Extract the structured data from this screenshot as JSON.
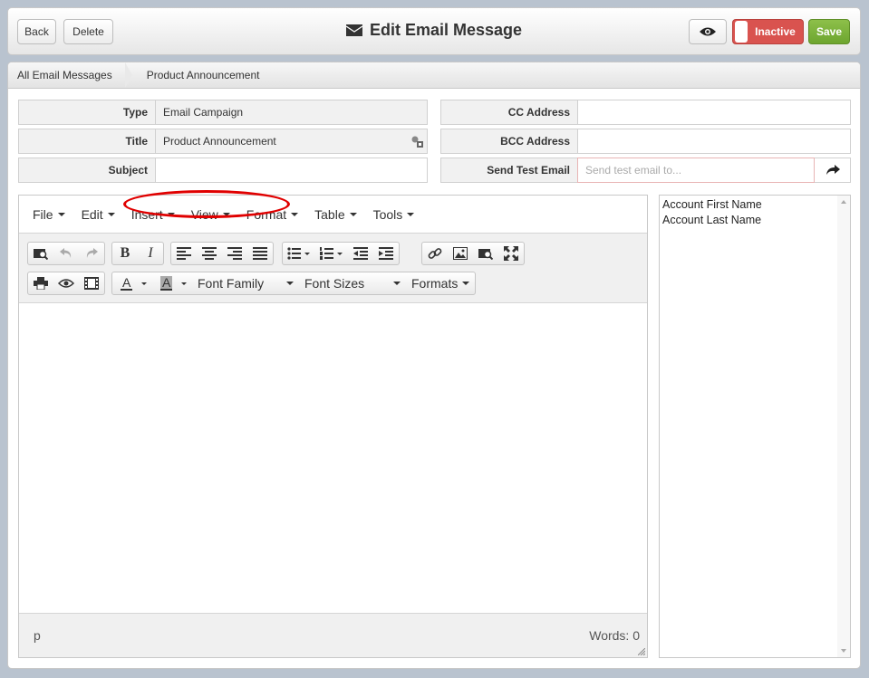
{
  "header": {
    "back_label": "Back",
    "delete_label": "Delete",
    "title": "Edit Email Message",
    "status_label": "Inactive",
    "save_label": "Save"
  },
  "breadcrumb": [
    "All Email Messages",
    "Product Announcement"
  ],
  "form": {
    "type": {
      "label": "Type",
      "value": "Email Campaign"
    },
    "title": {
      "label": "Title",
      "value": "Product Announcement"
    },
    "subject": {
      "label": "Subject",
      "value": ""
    },
    "cc": {
      "label": "CC Address",
      "value": ""
    },
    "bcc": {
      "label": "BCC Address",
      "value": ""
    },
    "test": {
      "label": "Send Test Email",
      "placeholder": "Send test email to..."
    }
  },
  "editor": {
    "menus": [
      "File",
      "Edit",
      "Insert",
      "View",
      "Format",
      "Table",
      "Tools"
    ],
    "font_family_label": "Font Family",
    "font_sizes_label": "Font Sizes",
    "formats_label": "Formats",
    "status_path": "p",
    "word_count": "Words: 0"
  },
  "merge_fields": [
    "Account First Name",
    "Account Last Name"
  ],
  "colors": {
    "inactive": "#d9534f",
    "save": "#7ab03c",
    "annotation": "#e00000"
  }
}
